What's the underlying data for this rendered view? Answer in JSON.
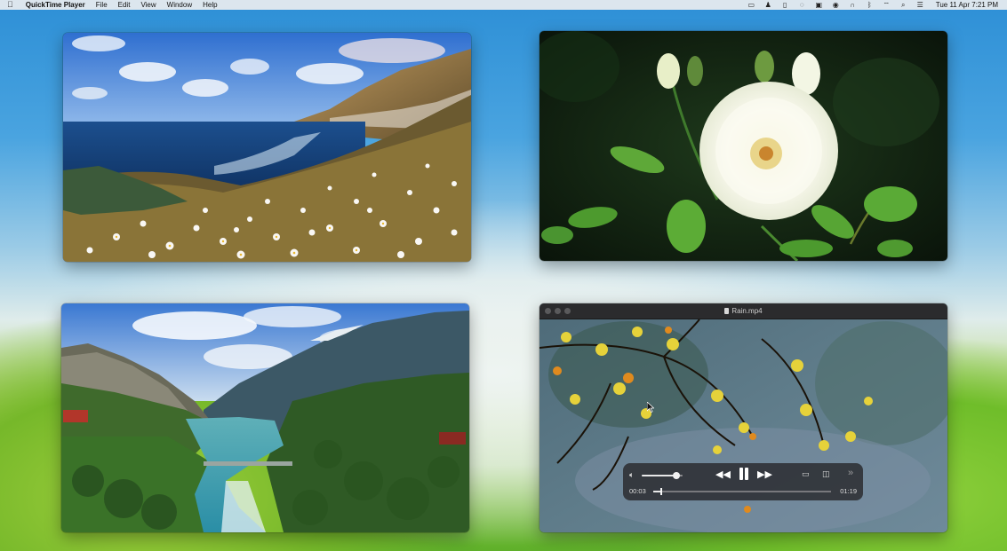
{
  "menubar": {
    "apple_icon": "apple-logo-icon",
    "app_name": "QuickTime Player",
    "menus": [
      "File",
      "Edit",
      "View",
      "Window",
      "Help"
    ],
    "status_icons": [
      "display-icon",
      "person-icon",
      "battery-icon",
      "paperclip-icon",
      "screen-icon",
      "play-icon",
      "headphones-icon",
      "bluetooth-icon",
      "wifi-icon",
      "search-icon",
      "control-center-icon"
    ],
    "clock": "Tue 11 Apr  7:21 PM"
  },
  "windows": {
    "player4": {
      "title": "Rain.mp4",
      "time_elapsed": "00:03",
      "time_remaining": "01:19",
      "volume_level": 0.85,
      "progress": 0.04,
      "playback_state": "playing"
    }
  },
  "colors": {
    "player_bg": "#2b2b2d",
    "controls_bg": "#28282c"
  }
}
